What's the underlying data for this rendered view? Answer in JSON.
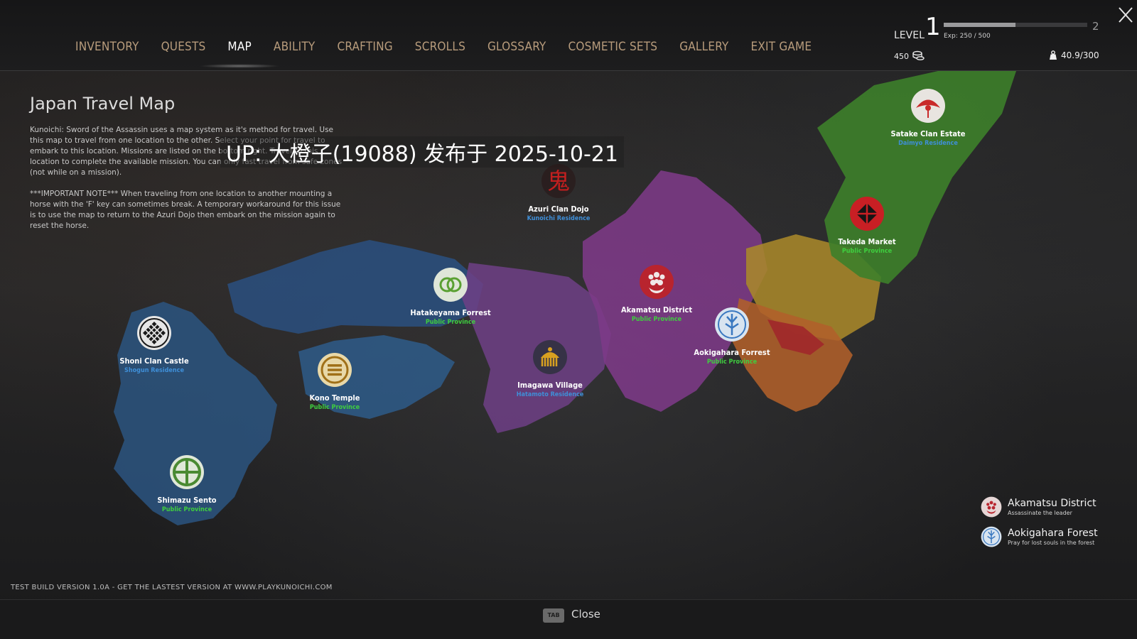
{
  "nav": {
    "items": [
      "INVENTORY",
      "QUESTS",
      "MAP",
      "ABILITY",
      "CRAFTING",
      "SCROLLS",
      "GLOSSARY",
      "COSMETIC SETS",
      "GALLERY",
      "EXIT GAME"
    ],
    "active": "MAP"
  },
  "player": {
    "level_label": "LEVEL",
    "level": "1",
    "next_level": "2",
    "exp_text": "Exp: 250 / 500",
    "exp_progress": 0.5,
    "coins": "450",
    "weight": "40.9/300"
  },
  "panel": {
    "title": "Japan Travel Map",
    "description": "Kunoichi: Sword of the Assassin uses a map system as it's method for travel. Use this map to travel from one location to the other. Select your point for travel to embark to this location. Missions are listed on the bottom right. Travel to this location to complete the available mission. You can only fast travel from safe zones (not while on a mission).",
    "note": "***IMPORTANT NOTE*** When traveling from one location to another mounting a horse with the 'F' key can sometimes break. A temporary workaround for this issue is to use the map to return to the Azuri Dojo then embark on the mission again to reset the horse."
  },
  "watermark": "UP: 大橙子(19088) 发布于 2025-10-21",
  "locations": [
    {
      "name": "Satake Clan Estate",
      "type": "Daimyo Residence",
      "icon": "fan-crest-icon"
    },
    {
      "name": "Azuri Clan Dojo",
      "type": "Kunoichi Residence",
      "icon": "kanji-crest-icon"
    },
    {
      "name": "Takeda Market",
      "type": "Public Province",
      "icon": "diamond-crest-icon"
    },
    {
      "name": "Akamatsu District",
      "type": "Public Province",
      "icon": "paulownia-crest-icon"
    },
    {
      "name": "Hatakeyama Forrest",
      "type": "Public Province",
      "icon": "rings-crest-icon"
    },
    {
      "name": "Aokigahara Forrest",
      "type": "Public Province",
      "icon": "bamboo-crest-icon"
    },
    {
      "name": "Shoni Clan Castle",
      "type": "Shogun Residence",
      "icon": "lattice-crest-icon"
    },
    {
      "name": "Imagawa Village",
      "type": "Hatamoto Residence",
      "icon": "comb-crest-icon"
    },
    {
      "name": "Kono Temple",
      "type": "Public Province",
      "icon": "bars-crest-icon"
    },
    {
      "name": "Shimazu Sento",
      "type": "Public Province",
      "icon": "cross-circle-crest-icon"
    }
  ],
  "missions": [
    {
      "title": "Akamatsu District",
      "subtitle": "Assassinate the leader",
      "icon": "paulownia-crest-icon"
    },
    {
      "title": "Aokigahara Forest",
      "subtitle": "Pray for lost souls in the forest",
      "icon": "bamboo-crest-icon"
    }
  ],
  "footer": {
    "build": "TEST BUILD VERSION 1.0A - GET THE LASTEST VERSION AT WWW.PLAYKUNOICHI.COM",
    "tab_key": "TAB",
    "close_label": "Close"
  },
  "colors": {
    "nav_text": "#b89c7c",
    "public_province": "#3fcf3f",
    "residence": "#3f8fd8",
    "region_blue": "#2b5a86",
    "region_purple": "#7a3a8a",
    "region_green": "#3f8a2a",
    "region_orange": "#b4632a",
    "region_yellow": "#b08a2a"
  }
}
